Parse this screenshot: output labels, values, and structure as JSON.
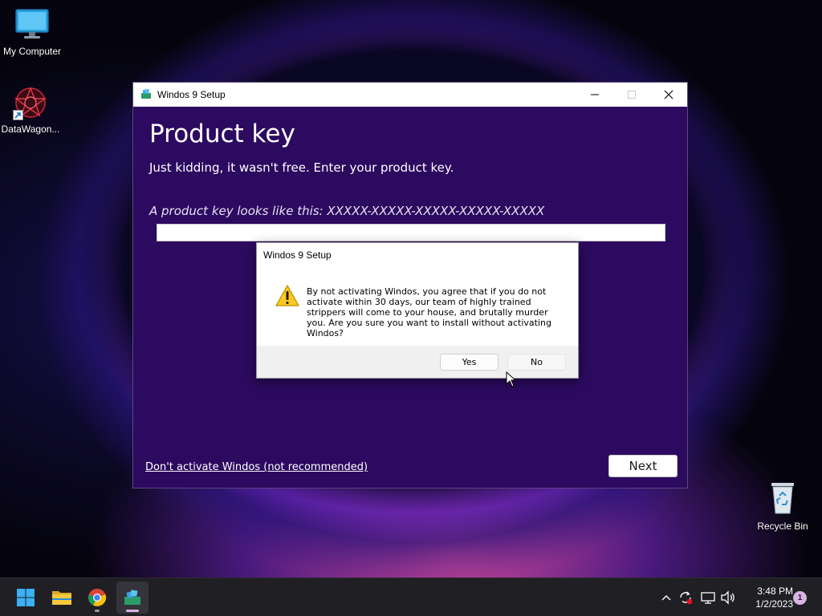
{
  "desktop": {
    "icons": [
      {
        "label": "My Computer",
        "icon": "monitor-icon"
      },
      {
        "label": "DataWagon...",
        "icon": "datawagon-logo-icon"
      },
      {
        "label": "Recycle Bin",
        "icon": "recycle-bin-icon"
      }
    ]
  },
  "setup_window": {
    "title": "Windos 9 Setup",
    "heading": "Product key",
    "subtitle": "Just kidding, it wasn't free. Enter your product key.",
    "hint": "A product key looks like this: XXXXX-XXXXX-XXXXX-XXXXX-XXXXX",
    "product_key_value": "",
    "dont_activate_link": "Don't activate Windos (not recommended)",
    "next_label": "Next",
    "background_color": "#2c0a60"
  },
  "dialog": {
    "title": "Windos 9 Setup",
    "icon": "warning-icon",
    "message": "By not activating Windos, you agree that if you do not activate within 30 days, our team of highly trained strippers will come to your house, and brutally murder you. Are you sure you want to install without activating Windos?",
    "yes_label": "Yes",
    "no_label": "No"
  },
  "taskbar": {
    "items": [
      {
        "name": "start",
        "icon": "windows-logo-icon"
      },
      {
        "name": "file-explorer",
        "icon": "folder-icon"
      },
      {
        "name": "chrome",
        "icon": "chrome-icon"
      },
      {
        "name": "windos-setup",
        "icon": "setup-icon",
        "active": true
      }
    ],
    "tray": {
      "time": "3:48 PM",
      "date": "1/2/2023",
      "notification_count": "1"
    },
    "accent_color": "#d9b3e6"
  }
}
